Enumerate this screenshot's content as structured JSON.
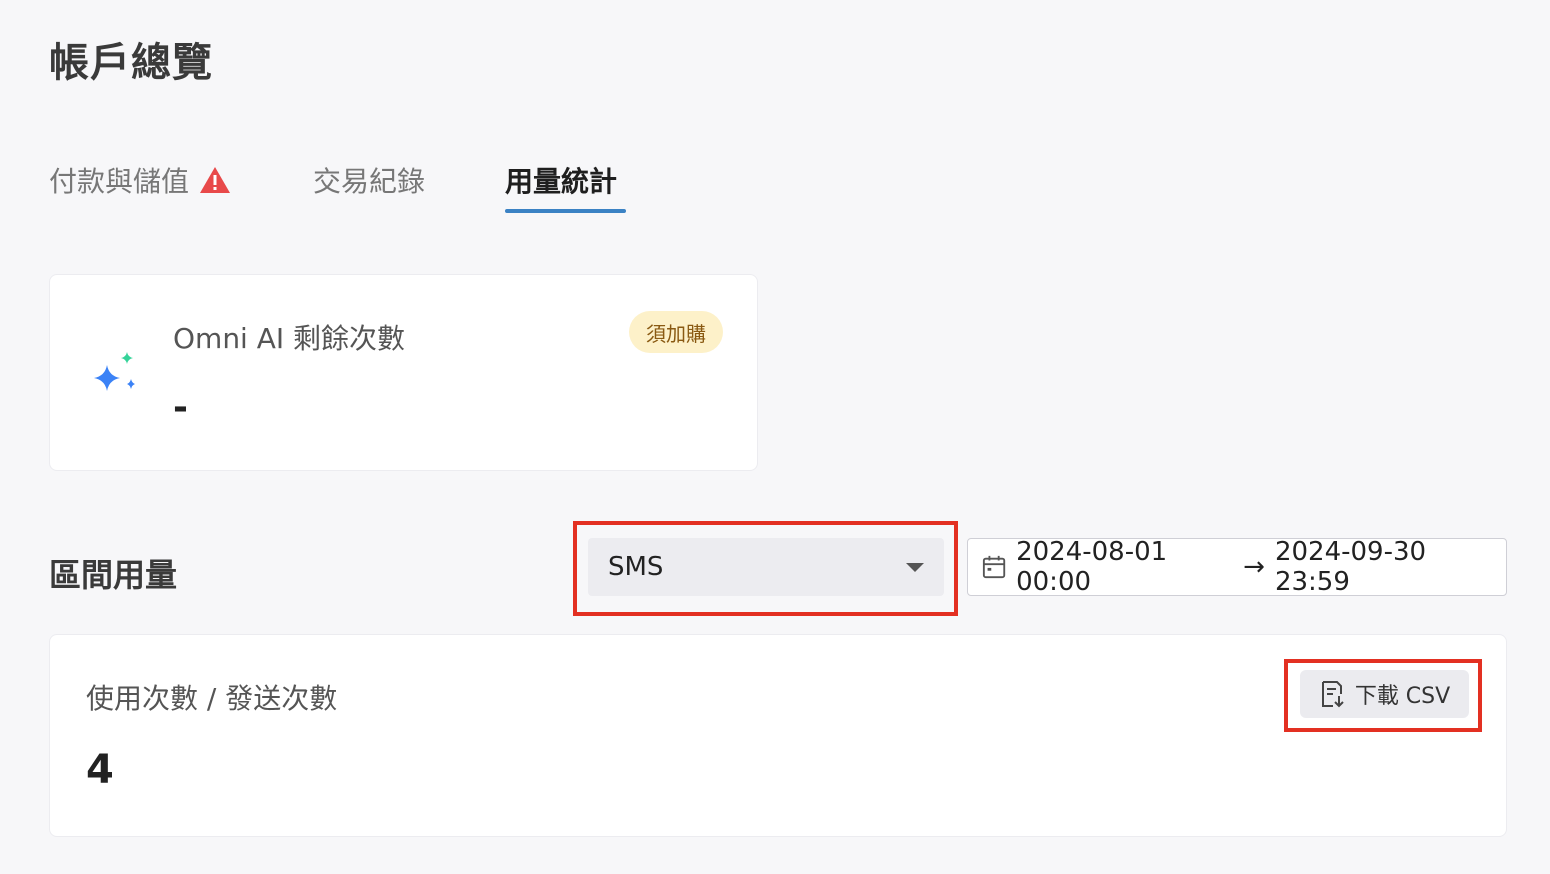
{
  "page": {
    "title": "帳戶總覽"
  },
  "tabs": [
    {
      "label": "付款與儲值",
      "has_warning": true
    },
    {
      "label": "交易紀錄"
    },
    {
      "label": "用量統計",
      "active": true
    }
  ],
  "ai_card": {
    "title": "Omni AI 剩餘次數",
    "value": "-",
    "badge": "須加購",
    "icon": "sparkle-icon"
  },
  "interval": {
    "title": "區間用量",
    "channel_select": {
      "value": "SMS"
    },
    "date_range": {
      "start": "2024-08-01 00:00",
      "arrow": "→",
      "end": "2024-09-30 23:59"
    }
  },
  "usage": {
    "label": "使用次數 / 發送次數",
    "value": "4",
    "download_label": "下載 CSV"
  },
  "colors": {
    "accent": "#3b82c4",
    "highlight": "#e33022",
    "warning": "#e8494a",
    "badge_bg": "#fdf1c9"
  }
}
